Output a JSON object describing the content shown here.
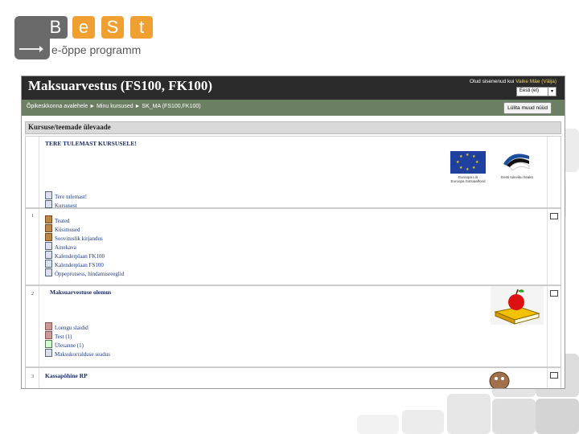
{
  "logo": {
    "letters": [
      "B",
      "e",
      "S",
      "t"
    ],
    "subtitle": "e-õppe programm"
  },
  "header": {
    "course_title": "Maksuarvestus (FS100, FK100)",
    "login_prefix": "Olud sisenenud kui",
    "login_user": "Vaike Mäe",
    "login_logout": "(Välja)",
    "language": "Eesti (et)"
  },
  "navbar": {
    "breadcrumb": "Õpikeskkonna avalehele ► Minu kursused ► SK_MA (FS100,FK100)",
    "edit_button": "Lülita muud nüüd"
  },
  "overview": {
    "heading": "Kursuse/teemade ülevaade"
  },
  "section0": {
    "welcome": "TERE TULEMAST KURSUSELE!",
    "resources": [
      "Tere tulemast!",
      "Kursusest"
    ],
    "eu_caption_1": "Euroopa Liit",
    "eu_caption_2": "Euroopa Sotsiaalfond",
    "est_caption": "Eesti tuleviku heaks"
  },
  "section1": {
    "num": "1",
    "resources": [
      "Teated",
      "Küsimused",
      "Soovituslik kirjandus",
      "Ainekava",
      "Kalenderplaan FK100",
      "Kalenderplaan FS100",
      "Õppeprotsess, hindamisreeglid"
    ]
  },
  "section2": {
    "num": "2",
    "title": "Maksuarvestuse olemus",
    "resources": [
      "Loengu slaidid",
      "Test (1)",
      "Ülesanne (1)",
      "Maksukorralduse seadus"
    ]
  },
  "section3": {
    "num": "3",
    "title": "Kassapõhine RP"
  },
  "colors": {
    "header_bg": "#2b2b2b",
    "navbar_bg": "#6b7f62",
    "logo_orange": "#f0a030",
    "logo_gray": "#6a6a6a"
  },
  "icons": [
    "page-icon",
    "forum-icon",
    "quiz-icon",
    "assignment-icon",
    "checkbox-icon",
    "apple-book-icon",
    "eu-flag-icon"
  ]
}
